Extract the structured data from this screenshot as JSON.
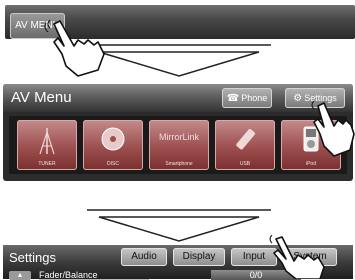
{
  "step1": {
    "av_menu_label": "AV MENU"
  },
  "step2": {
    "title": "AV Menu",
    "phone_label": "Phone",
    "settings_label": "Settings",
    "sources": [
      {
        "id": "tuner",
        "label": "TUNER",
        "icon": "antenna-icon"
      },
      {
        "id": "disc",
        "label": "DISC",
        "icon": "disc-icon"
      },
      {
        "id": "mirrorlink",
        "big": "MirrorLink",
        "label": "Smartphone",
        "icon": ""
      },
      {
        "id": "usb",
        "label": "USB",
        "icon": "usb-icon"
      },
      {
        "id": "ipod",
        "label": "iPod",
        "icon": "ipod-icon"
      }
    ]
  },
  "step3": {
    "title": "Settings",
    "tabs": [
      "Audio",
      "Display",
      "Input",
      "System"
    ],
    "item_label": "Fader/Balance",
    "item_value": "0/0"
  },
  "colors": {
    "source_tile": "#9d4f4f",
    "header_dark": "#2c2c2c"
  }
}
